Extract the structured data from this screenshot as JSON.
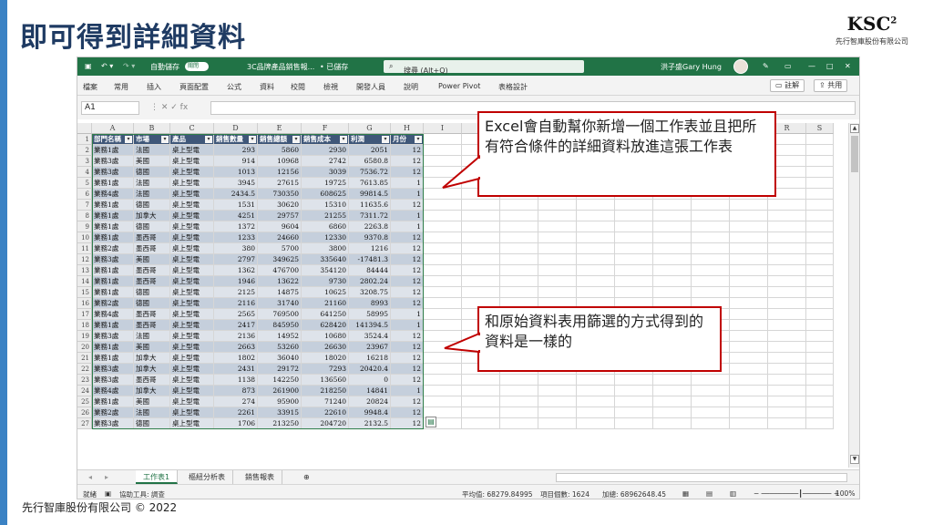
{
  "slide": {
    "title": "即可得到詳細資料",
    "logo_text": "KSC",
    "logo_sup": "2",
    "logo_sub": "先行智庫股份有限公司",
    "footer": "先行智庫股份有限公司 © 2022",
    "accent_color": "#3b82c4"
  },
  "excel": {
    "autosave_label": "自動儲存",
    "autosave_state": "關閉",
    "filename": "3C品牌產品銷售報...",
    "saved_status": "• 已儲存",
    "search_placeholder": "搜尋 (Alt+Q)",
    "user_name": "洪子盛Gary Hung",
    "menu": [
      "檔案",
      "常用",
      "插入",
      "頁面配置",
      "公式",
      "資料",
      "校閱",
      "檢視",
      "開發人員",
      "說明",
      "Power Pivot",
      "表格設計"
    ],
    "comments_label": "註解",
    "share_label": "共用",
    "name_box": "A1",
    "formula_buttons": "⋮   ✕   ✓   fx",
    "columns": [
      "A",
      "B",
      "C",
      "D",
      "E",
      "F",
      "G",
      "H",
      "I",
      "J",
      "K",
      "L",
      "M",
      "N",
      "O",
      "P",
      "Q",
      "R",
      "S"
    ],
    "headers": [
      "部門名稱",
      "市場",
      "產品",
      "銷售數量",
      "銷售總額",
      "銷售成本",
      "利潤",
      "月份"
    ],
    "rows": [
      [
        "業務1處",
        "法國",
        "桌上型電",
        "293",
        "5860",
        "2930",
        "2051",
        "12"
      ],
      [
        "業務3處",
        "美國",
        "桌上型電",
        "914",
        "10968",
        "2742",
        "6580.8",
        "12"
      ],
      [
        "業務3處",
        "德國",
        "桌上型電",
        "1013",
        "12156",
        "3039",
        "7536.72",
        "12"
      ],
      [
        "業務1處",
        "法國",
        "桌上型電",
        "3945",
        "27615",
        "19725",
        "7613.85",
        "1"
      ],
      [
        "業務4處",
        "法國",
        "桌上型電",
        "2434.5",
        "730350",
        "608625",
        "99814.5",
        "1"
      ],
      [
        "業務1處",
        "德國",
        "桌上型電",
        "1531",
        "30620",
        "15310",
        "11635.6",
        "12"
      ],
      [
        "業務1處",
        "加拿大",
        "桌上型電",
        "4251",
        "29757",
        "21255",
        "7311.72",
        "1"
      ],
      [
        "業務1處",
        "德國",
        "桌上型電",
        "1372",
        "9604",
        "6860",
        "2263.8",
        "1"
      ],
      [
        "業務1處",
        "墨西哥",
        "桌上型電",
        "1233",
        "24660",
        "12330",
        "9370.8",
        "12"
      ],
      [
        "業務2處",
        "墨西哥",
        "桌上型電",
        "380",
        "5700",
        "3800",
        "1216",
        "12"
      ],
      [
        "業務3處",
        "美國",
        "桌上型電",
        "2797",
        "349625",
        "335640",
        "-17481.3",
        "12"
      ],
      [
        "業務1處",
        "墨西哥",
        "桌上型電",
        "1362",
        "476700",
        "354120",
        "84444",
        "12"
      ],
      [
        "業務1處",
        "墨西哥",
        "桌上型電",
        "1946",
        "13622",
        "9730",
        "2802.24",
        "12"
      ],
      [
        "業務1處",
        "德國",
        "桌上型電",
        "2125",
        "14875",
        "10625",
        "3208.75",
        "12"
      ],
      [
        "業務2處",
        "德國",
        "桌上型電",
        "2116",
        "31740",
        "21160",
        "8993",
        "12"
      ],
      [
        "業務4處",
        "墨西哥",
        "桌上型電",
        "2565",
        "769500",
        "641250",
        "58995",
        "1"
      ],
      [
        "業務1處",
        "墨西哥",
        "桌上型電",
        "2417",
        "845950",
        "628420",
        "141394.5",
        "1"
      ],
      [
        "業務3處",
        "法國",
        "桌上型電",
        "2136",
        "14952",
        "10680",
        "3524.4",
        "12"
      ],
      [
        "業務1處",
        "美國",
        "桌上型電",
        "2663",
        "53260",
        "26630",
        "23967",
        "12"
      ],
      [
        "業務1處",
        "加拿大",
        "桌上型電",
        "1802",
        "36040",
        "18020",
        "16218",
        "12"
      ],
      [
        "業務3處",
        "加拿大",
        "桌上型電",
        "2431",
        "29172",
        "7293",
        "20420.4",
        "12"
      ],
      [
        "業務3處",
        "墨西哥",
        "桌上型電",
        "1138",
        "142250",
        "136560",
        "0",
        "12"
      ],
      [
        "業務4處",
        "加拿大",
        "桌上型電",
        "873",
        "261900",
        "218250",
        "14841",
        "1"
      ],
      [
        "業務1處",
        "美國",
        "桌上型電",
        "274",
        "95900",
        "71240",
        "20824",
        "12"
      ],
      [
        "業務2處",
        "法國",
        "桌上型電",
        "2261",
        "33915",
        "22610",
        "9948.4",
        "12"
      ],
      [
        "業務3處",
        "德國",
        "桌上型電",
        "1706",
        "213250",
        "204720",
        "2132.5",
        "12"
      ]
    ],
    "sheet_tabs": [
      "工作表1",
      "樞紐分析表",
      "銷售報表"
    ],
    "add_sheet": "⊕",
    "status_ready": "就緒",
    "status_accessibility": "協助工具: 調查",
    "status_average": "平均值: 68279.84995",
    "status_count": "項目個數: 1624",
    "status_sum": "加總: 68962648.45",
    "zoom": "100%"
  },
  "callouts": {
    "top": "Excel會自動幫你新增一個工作表並且把所有符合條件的詳細資料放進這張工作表",
    "bottom": "和原始資料表用篩選的方式得到的資料是一樣的"
  }
}
